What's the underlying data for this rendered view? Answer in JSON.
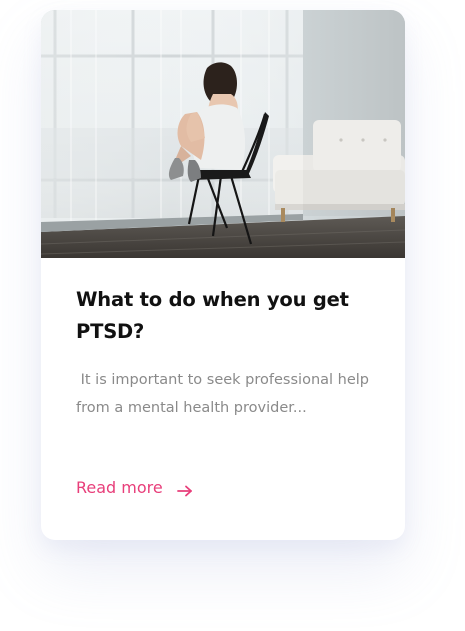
{
  "card": {
    "title": "What to do when you get PTSD?",
    "excerpt": " It is important to seek professional help from a mental health provider...",
    "read_more_label": "Read more",
    "read_more_icon": "arrow-right-icon",
    "accent_color": "#e83e7a"
  }
}
